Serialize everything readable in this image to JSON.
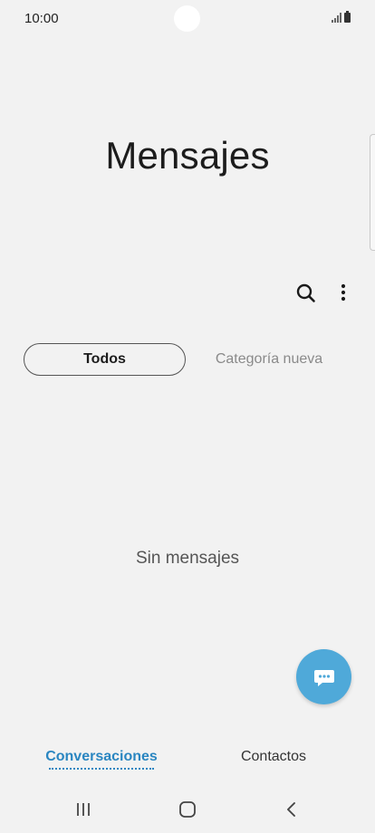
{
  "status_bar": {
    "time": "10:00",
    "icons": [
      "signal-icon",
      "battery-icon"
    ]
  },
  "header": {
    "title": "Mensajes"
  },
  "toolbar": {
    "icons": [
      "search-icon",
      "more-vert-icon"
    ]
  },
  "category_tabs": [
    {
      "label": "Todos",
      "selected": true
    },
    {
      "label": "Categoría nueva",
      "selected": false
    }
  ],
  "empty_state": {
    "text": "Sin mensajes"
  },
  "fab": {
    "icon": "compose-message-icon",
    "color": "#4fa9d9"
  },
  "bottom_tabs": [
    {
      "label": "Conversaciones",
      "selected": true
    },
    {
      "label": "Contactos",
      "selected": false
    }
  ],
  "nav_bar": {
    "icons": [
      "recents-icon",
      "home-icon",
      "back-icon"
    ]
  },
  "colors": {
    "background": "#f2f2f2",
    "accent": "#2a86c1"
  }
}
